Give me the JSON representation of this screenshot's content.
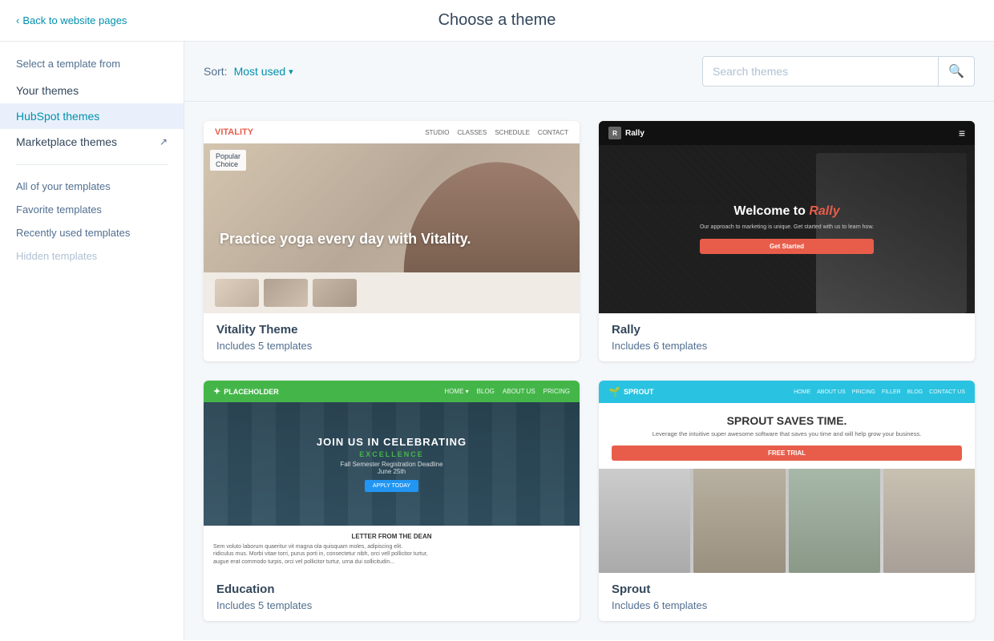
{
  "header": {
    "back_label": "Back to website pages",
    "title": "Choose a theme"
  },
  "sidebar": {
    "section_label": "Select a template from",
    "nav_items": [
      {
        "id": "your-themes",
        "label": "Your themes",
        "active": false
      },
      {
        "id": "hubspot-themes",
        "label": "HubSpot themes",
        "active": true
      },
      {
        "id": "marketplace-themes",
        "label": "Marketplace themes",
        "active": false,
        "external": true
      }
    ],
    "sub_items": [
      {
        "id": "all-templates",
        "label": "All of your templates",
        "muted": false
      },
      {
        "id": "favorite-templates",
        "label": "Favorite templates",
        "muted": false
      },
      {
        "id": "recently-used",
        "label": "Recently used templates",
        "muted": false
      },
      {
        "id": "hidden-templates",
        "label": "Hidden templates",
        "muted": true
      }
    ]
  },
  "sort_bar": {
    "sort_label": "Sort:",
    "sort_value": "Most used",
    "search_placeholder": "Search themes"
  },
  "themes": [
    {
      "id": "vitality",
      "name": "Vitality Theme",
      "templates_count": "Includes 5 templates",
      "popular": true,
      "popular_label": "Popular"
    },
    {
      "id": "rally",
      "name": "Rally",
      "templates_count": "Includes 6 templates",
      "popular": false
    },
    {
      "id": "education",
      "name": "Education",
      "templates_count": "Includes 5 templates",
      "popular": false
    },
    {
      "id": "sprout",
      "name": "Sprout",
      "templates_count": "Includes 6 templates",
      "popular": false
    }
  ],
  "vitality": {
    "logo": "VITALITY",
    "nav_links": [
      "STUDIO",
      "CLASSES",
      "SCHEDULE",
      "CONTACT"
    ],
    "hero_text": "Practice yoga every day with Vitality."
  },
  "rally": {
    "logo": "Rally",
    "hero_heading_start": "Welcome to",
    "hero_heading_accent": "Rally",
    "hero_subtext": "Our approach to marketing is unique. Get started with us to learn how.",
    "cta_label": "Get Started"
  },
  "education": {
    "nav_links": [
      "HOME",
      "BLOG",
      "ABOUT US",
      "PRICING"
    ],
    "hero_heading": "JOIN US IN CELEBRATING",
    "hero_accent": "EXCELLENCE",
    "hero_date": "Fall Semester Registration Deadline",
    "cta_label": "APPLY TODAY",
    "letter_title": "LETTER FROM THE DEAN"
  },
  "sprout": {
    "logo": "SPROUT",
    "nav_links": [
      "HOME",
      "ABOUT US",
      "PRICING",
      "FILLER",
      "BLOG",
      "CONTACT US"
    ],
    "heading": "SPROUT SAVES TIME.",
    "subtext": "Leverage the intuitive super awesome software that saves you time and will help grow your business.",
    "cta_label": "FREE TRIAL"
  }
}
